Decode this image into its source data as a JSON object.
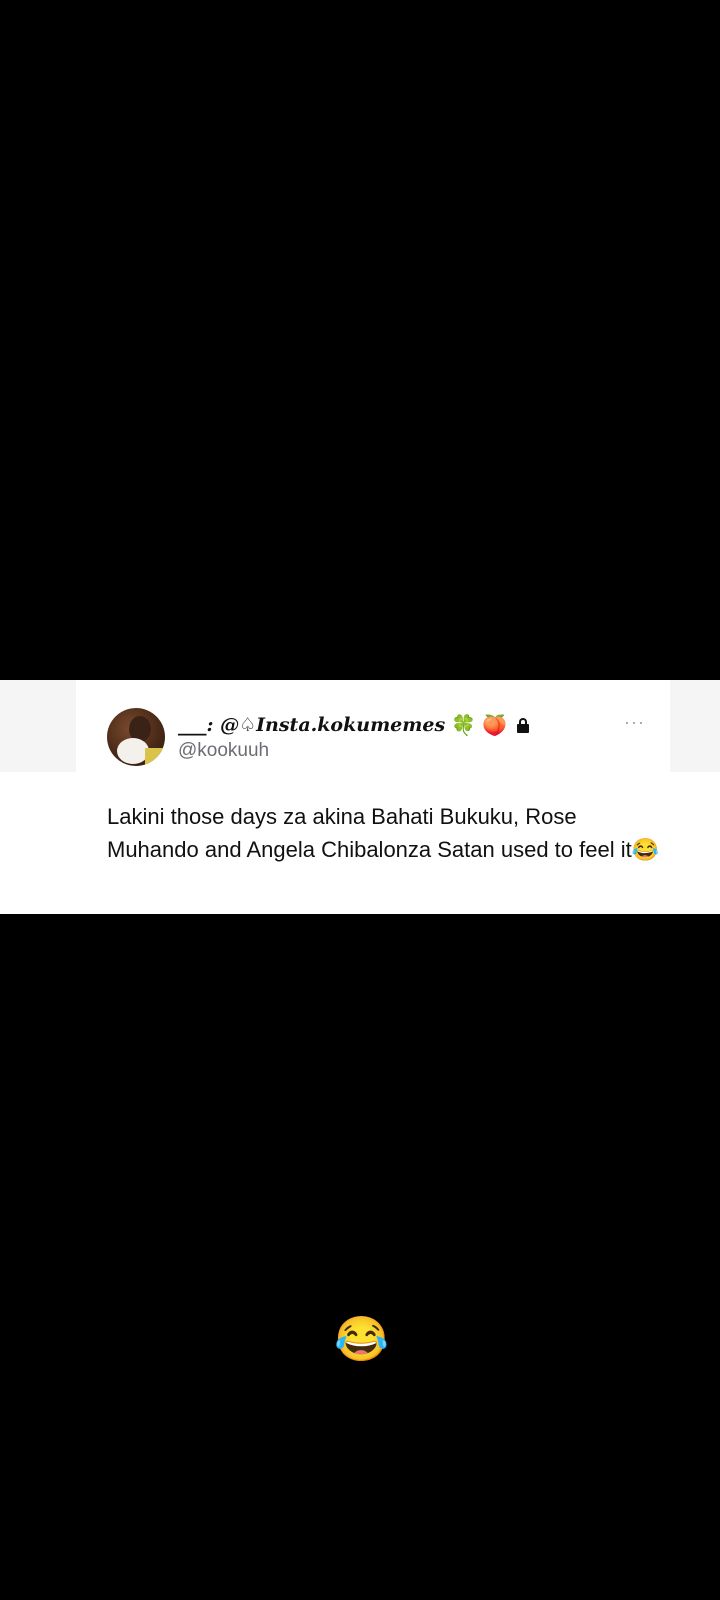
{
  "tweet": {
    "display_name": "___: @♤Insta.kokumemes",
    "name_emojis": [
      "🍀",
      "🍑"
    ],
    "handle": "@kookuuh",
    "text": "Lakini those days za akina Bahati Bukuku, Rose Muhando and Angela Chibalonza Satan used to feel it😂",
    "more_label": "···"
  },
  "reaction": {
    "emoji": "😂"
  }
}
